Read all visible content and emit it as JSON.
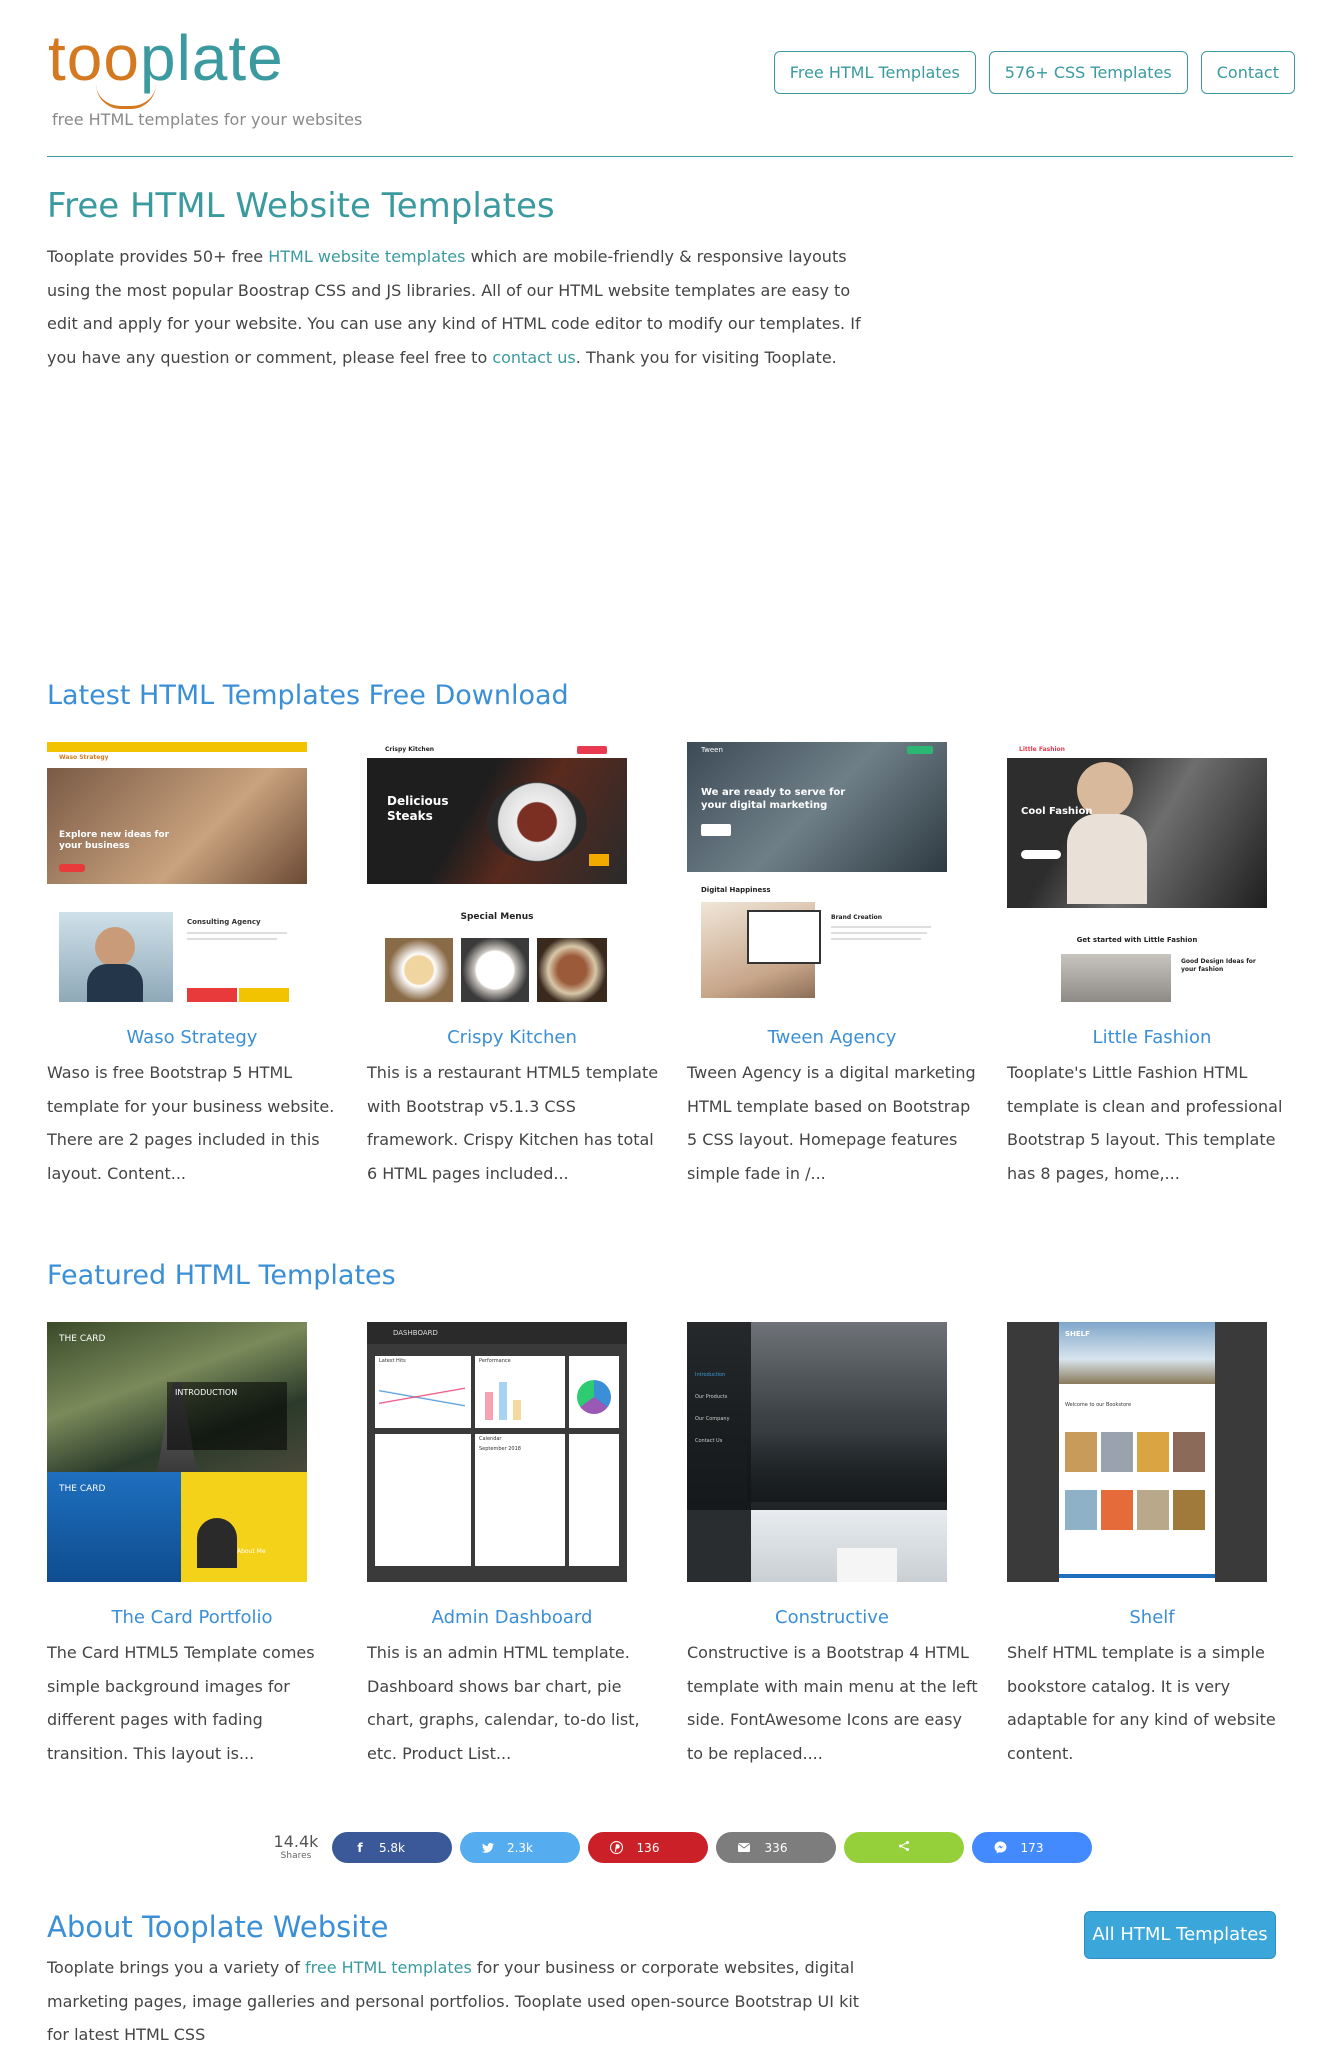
{
  "header": {
    "logo_too": "too",
    "logo_plate": "plate",
    "tagline": "free HTML templates for your websites",
    "nav": [
      "Free HTML Templates",
      "576+ CSS Templates",
      "Contact"
    ]
  },
  "hero": {
    "title": "Free HTML Website Templates",
    "p1": "Tooplate provides 50+ free ",
    "link1": "HTML website templates",
    "p2": " which are mobile-friendly & responsive layouts using the most popular Boostrap CSS and JS libraries. All of our HTML website templates are easy to edit and apply for your website. You can use any kind of HTML code editor to modify our templates. If you have any question or comment, please feel free to ",
    "link2": "contact us",
    "p3": ". Thank you for visiting Tooplate."
  },
  "latest": {
    "title": "Latest HTML Templates Free Download",
    "cards": [
      {
        "title": "Waso Strategy",
        "desc": "Waso is free Bootstrap 5 HTML template for your business website. There are 2 pages included in this layout. Content...",
        "thumb_text": [
          "Waso Strategy",
          "Explore new ideas for your business",
          "Consulting Agency"
        ]
      },
      {
        "title": "Crispy Kitchen",
        "desc": "This is a restaurant HTML5 template with Bootstrap v5.1.3 CSS framework. Crispy Kitchen has total 6 HTML pages included...",
        "thumb_text": [
          "Crispy Kitchen",
          "Delicious Steaks",
          "Special Menus"
        ]
      },
      {
        "title": "Tween Agency",
        "desc": "Tween Agency is a digital marketing HTML template based on Bootstrap 5 CSS layout. Homepage features simple fade in /...",
        "thumb_text": [
          "Tween",
          "We are ready to serve for your digital marketing",
          "Digital Happiness",
          "Brand Creation"
        ]
      },
      {
        "title": "Little Fashion",
        "desc": "Tooplate's Little Fashion HTML template is clean and professional Bootstrap 5 layout. This template has 8 pages, home,...",
        "thumb_text": [
          "Little Fashion",
          "Cool Fashion",
          "Get started with Little Fashion",
          "Good Design Ideas for your fashion"
        ]
      }
    ]
  },
  "featured": {
    "title": "Featured HTML Templates",
    "cards": [
      {
        "title": "The Card Portfolio",
        "desc": "The Card HTML5 Template comes simple background images for different pages with fading transition. This layout is...",
        "thumb_text": [
          "THE CARD",
          "INTRODUCTION",
          "THE CARD",
          "About Me"
        ]
      },
      {
        "title": "Admin Dashboard",
        "desc": "This is an admin HTML template. Dashboard shows bar chart, pie chart, graphs, calendar, to-do list, etc. Product List...",
        "thumb_text": [
          "DASHBOARD",
          "Latest Hits",
          "Performance",
          "Calendar",
          "September 2018"
        ]
      },
      {
        "title": "Constructive",
        "desc": "Constructive is a Bootstrap 4 HTML template with main menu at the left side. FontAwesome Icons are easy to be replaced....",
        "thumb_text": [
          "Introduction",
          "Our Products",
          "Our Company",
          "Contact Us"
        ]
      },
      {
        "title": "Shelf",
        "desc": "Shelf HTML template is a simple bookstore catalog. It is very adaptable for any kind of website content.",
        "thumb_text": [
          "SHELF",
          "Welcome to our Bookstore"
        ]
      }
    ]
  },
  "shares": {
    "total": "14.4k",
    "label": "Shares",
    "buttons": [
      {
        "icon": "facebook-icon",
        "glyph": "f",
        "count": "5.8k",
        "color": "#3b5998"
      },
      {
        "icon": "twitter-icon",
        "glyph": "🐦",
        "count": "2.3k",
        "color": "#55acee"
      },
      {
        "icon": "pinterest-icon",
        "glyph": "P",
        "count": "136",
        "color": "#cb2027"
      },
      {
        "icon": "email-icon",
        "glyph": "✉",
        "count": "336",
        "color": "#7d7d7d"
      },
      {
        "icon": "share-icon",
        "glyph": "<",
        "count": "",
        "color": "#95d03a"
      },
      {
        "icon": "messenger-icon",
        "glyph": "✦",
        "count": "173",
        "color": "#448aff"
      }
    ]
  },
  "about": {
    "title": "About Tooplate Website",
    "button": "All HTML Templates",
    "p1": "Tooplate brings you a variety of ",
    "link1": "free HTML templates",
    "p2": " for your business or corporate websites, digital marketing pages, image galleries and personal portfolios. Tooplate used open-source Bootstrap UI kit for latest HTML CSS"
  }
}
